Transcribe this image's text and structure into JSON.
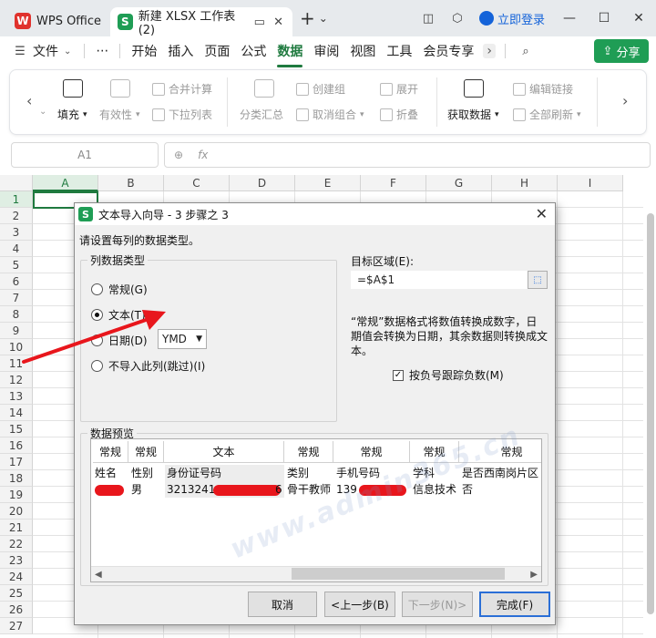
{
  "titlebar": {
    "app_name": "WPS Office",
    "doc_tab": "新建 XLSX 工作表 (2)",
    "login": "立即登录"
  },
  "menubar": {
    "file": "文件",
    "more": "⋯",
    "items": [
      "开始",
      "插入",
      "页面",
      "公式",
      "数据",
      "审阅",
      "视图",
      "工具",
      "会员专享"
    ],
    "active": "数据",
    "share": "分享"
  },
  "ribbon": {
    "fill": "填充",
    "validity": "有效性",
    "merge_calc": "合并计算",
    "dropdown_list": "下拉列表",
    "subtotal": "分类汇总",
    "create_group": "创建组",
    "ungroup": "取消组合",
    "expand": "展开",
    "collapse": "折叠",
    "get_data": "获取数据",
    "edit_links": "编辑链接",
    "refresh_all": "全部刷新"
  },
  "formula_bar": {
    "name_box": "A1",
    "fx": "fx"
  },
  "sheet": {
    "columns": [
      "A",
      "B",
      "C",
      "D",
      "E",
      "F",
      "G",
      "H",
      "I"
    ],
    "rows": [
      "1",
      "2",
      "3",
      "4",
      "5",
      "6",
      "7",
      "8",
      "9",
      "10",
      "11",
      "12",
      "13",
      "14",
      "15",
      "16",
      "17",
      "18",
      "19",
      "20",
      "21",
      "22",
      "23",
      "24",
      "25",
      "26",
      "27"
    ]
  },
  "dialog": {
    "title": "文本导入向导 - 3 步骤之 3",
    "instruction": "请设置每列的数据类型。",
    "group_label": "列数据类型",
    "options": [
      "常规(G)",
      "文本(T)",
      "日期(D)",
      "不导入此列(跳过)(I)"
    ],
    "selected_option": "文本(T)",
    "date_format": "YMD",
    "target_label": "目标区域(E):",
    "target_value": "=$A$1",
    "description_line1": "“常规”数据格式将数值转换成数字，日",
    "description_line2": "期值会转换为日期，其余数据则转换成文",
    "description_line3": "本。",
    "negative_follow": "按负号跟踪负数(M)",
    "preview_label": "数据预览",
    "preview": {
      "headers": [
        "常规",
        "常规",
        "文本",
        "常规",
        "常规",
        "常规",
        "常规"
      ],
      "row1": [
        "姓名",
        "性别",
        "身份证号码",
        "类别",
        "手机号码",
        "学科",
        "是否西南岗片区"
      ],
      "row2": [
        "",
        "男",
        "3213241",
        "骨干教师",
        "139",
        "信息技术",
        "否"
      ],
      "row2_id_tail": "6"
    },
    "buttons": {
      "cancel": "取消",
      "back": "<上一步(B)",
      "next": "下一步(N)>",
      "finish": "完成(F)"
    }
  },
  "watermark": "www.admin365.cn",
  "colors": {
    "accent_green": "#1f7a3f",
    "share_green": "#1f9d55",
    "wps_red": "#e0322d",
    "arrow_red": "#e8161c"
  }
}
